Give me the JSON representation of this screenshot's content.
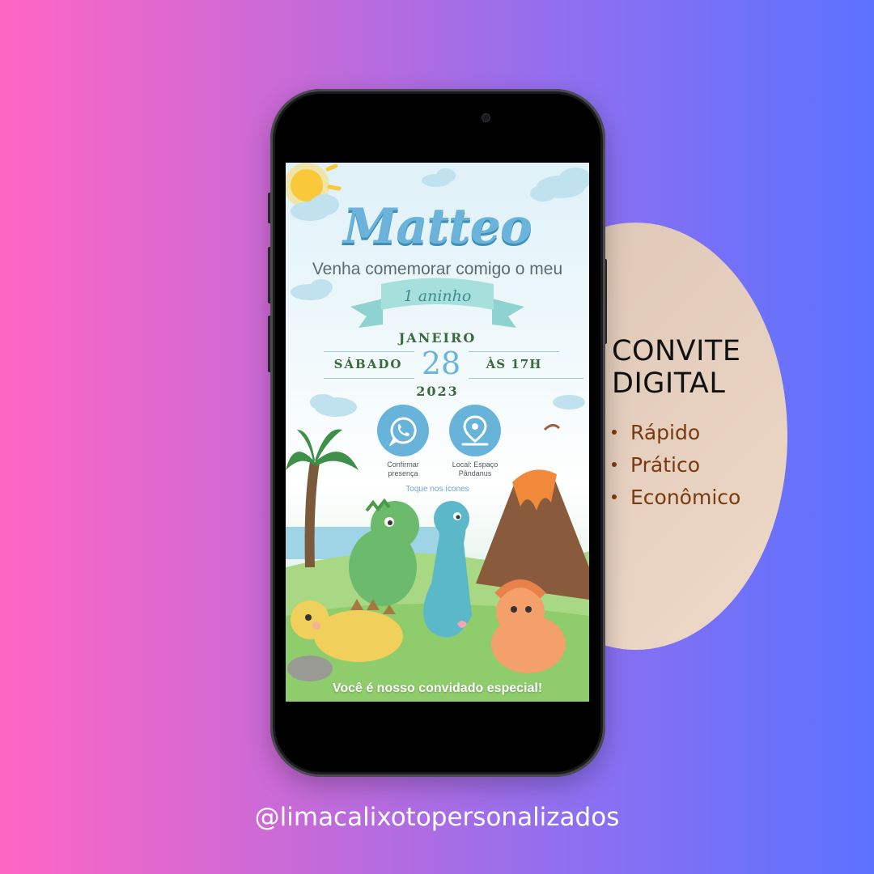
{
  "side_panel": {
    "title_line1": "CONVITE",
    "title_line2": "DIGITAL",
    "features": [
      "Rápido",
      "Prático",
      "Econômico"
    ]
  },
  "handle": "@limacalixotopersonalizados",
  "invitation": {
    "name": "Matteo",
    "invite_line": "Venha comemorar comigo o meu",
    "age": "1 aninho",
    "month": "JANEIRO",
    "weekday": "SÁBADO",
    "day": "28",
    "time": "ÀS 17H",
    "year": "2023",
    "confirm_label_line1": "Confirmar",
    "confirm_label_line2": "presença",
    "location_label_line1": "Local: Espaço",
    "location_label_line2": "Pândanus",
    "hint": "Toque nos ícones",
    "footer": "Você é nosso convidado especial!"
  },
  "icons": {
    "confirm": "whatsapp-icon",
    "location": "map-pin-icon"
  },
  "colors": {
    "accent_blue": "#68b3d9",
    "text_green": "#3a6a3a",
    "feature_brown": "#7a3a10",
    "circle_beige": "#e6cfbd"
  }
}
